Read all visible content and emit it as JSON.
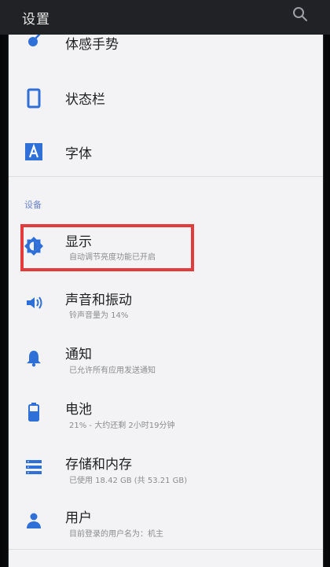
{
  "header": {
    "title": "设置",
    "search_icon": "search-icon"
  },
  "sections": {
    "device_header": "设备"
  },
  "items": [
    {
      "id": "gesture",
      "title": "体感手势",
      "subtitle": "",
      "icon": "gesture-icon"
    },
    {
      "id": "status_bar",
      "title": "状态栏",
      "subtitle": "",
      "icon": "status-bar-icon"
    },
    {
      "id": "font",
      "title": "字体",
      "subtitle": "",
      "icon": "font-icon"
    },
    {
      "id": "display",
      "title": "显示",
      "subtitle": "自动调节亮度功能已开启",
      "icon": "brightness-icon"
    },
    {
      "id": "sound",
      "title": "声音和振动",
      "subtitle": "铃声音量为 14%",
      "icon": "volume-icon"
    },
    {
      "id": "notifications",
      "title": "通知",
      "subtitle": "已允许所有应用发送通知",
      "icon": "bell-icon"
    },
    {
      "id": "battery",
      "title": "电池",
      "subtitle": "21% - 大约还剩 2小时19分钟",
      "icon": "battery-icon"
    },
    {
      "id": "storage",
      "title": "存储和内存",
      "subtitle": "已使用 18.42 GB (共 53.21 GB)",
      "icon": "storage-icon"
    },
    {
      "id": "users",
      "title": "用户",
      "subtitle": "目前登录的用户名为：机主",
      "icon": "user-icon"
    }
  ],
  "highlight": {
    "target": "display",
    "color": "#e33b3b"
  },
  "colors": {
    "accent": "#2f6fd8",
    "section_header": "#6c84cf",
    "panel_background": "#f3f3f5"
  }
}
